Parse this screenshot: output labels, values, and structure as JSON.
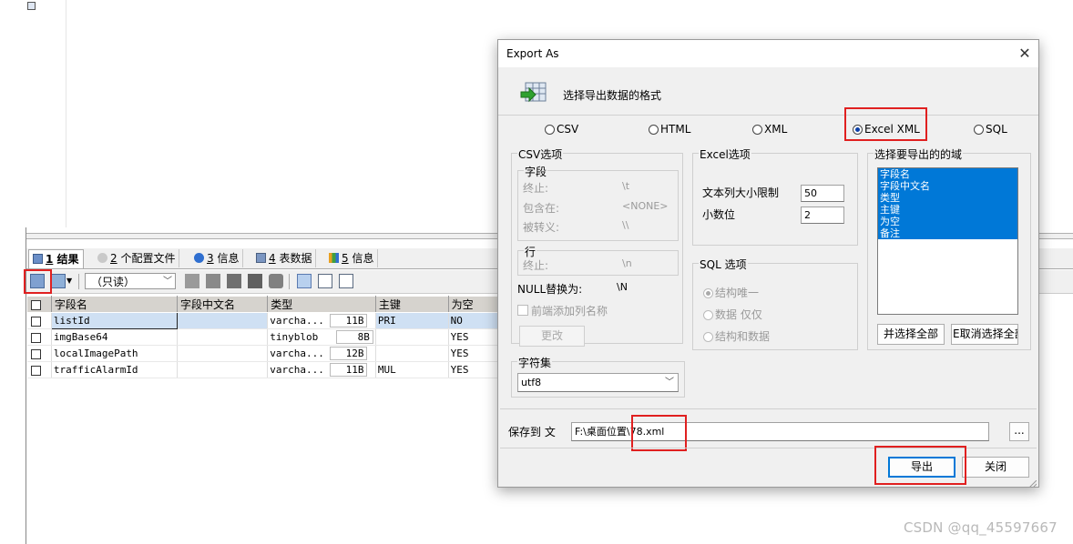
{
  "results_panel": {
    "tabs": [
      {
        "num": "1",
        "label": "结果"
      },
      {
        "num": "2",
        "label": "个配置文件"
      },
      {
        "num": "3",
        "label": "信息"
      },
      {
        "num": "4",
        "label": "表数据"
      },
      {
        "num": "5",
        "label": "信息"
      }
    ],
    "readonly_select": "（只读）",
    "columns": [
      "字段名",
      "字段中文名",
      "类型",
      "主键",
      "为空"
    ],
    "rows": [
      {
        "field": "listId",
        "cn_name": "",
        "type": "varcha...",
        "size": "11B",
        "key": "PRI",
        "nullable": "NO"
      },
      {
        "field": "imgBase64",
        "cn_name": "",
        "type": "tinyblob",
        "size": "8B",
        "key": "",
        "nullable": "YES"
      },
      {
        "field": "localImagePath",
        "cn_name": "",
        "type": "varcha...",
        "size": "12B",
        "key": "",
        "nullable": "YES"
      },
      {
        "field": "trafficAlarmId",
        "cn_name": "",
        "type": "varcha...",
        "size": "11B",
        "key": "MUL",
        "nullable": "YES"
      }
    ]
  },
  "export_dialog": {
    "title": "Export As",
    "close": "✕",
    "header_text": "选择导出数据的格式",
    "formats": [
      "CSV",
      "HTML",
      "XML",
      "Excel  XML",
      "SQL"
    ],
    "selected_format": "Excel  XML",
    "csv_options": {
      "title": "CSV选项",
      "field_group": "字段",
      "terminated_label": "终止:",
      "terminated_value": "\\t",
      "enclosed_label": "包含在:",
      "enclosed_value": "<NONE>",
      "escaped_label": "被转义:",
      "escaped_value": "\\\\",
      "line_group": "行",
      "line_terminated_label": "终止:",
      "line_terminated_value": "\\n",
      "null_label": "NULL替换为:",
      "null_value": "\\N",
      "add_header_label": "前端添加列名称",
      "change_button": "更改"
    },
    "excel_options": {
      "title": "Excel选项",
      "text_limit_label": "文本列大小限制",
      "text_limit_value": "50",
      "decimals_label": "小数位",
      "decimals_value": "2"
    },
    "sql_options": {
      "title": "SQL 选项",
      "opt1": "结构唯一",
      "opt2": "数据 仅仅",
      "opt3": "结构和数据"
    },
    "fields_section": {
      "title": "选择要导出的的域",
      "items": [
        "字段名",
        "字段中文名",
        "类型",
        "主键",
        "为空",
        "备注"
      ],
      "select_all": "并选择全部",
      "deselect_all": "E取消选择全部"
    },
    "charset": {
      "title": "字符集",
      "value": "utf8"
    },
    "save_to": {
      "label": "保存到 文",
      "value": "F:\\桌面位置\\78.xml",
      "browse": "..."
    },
    "export_button": "导出",
    "close_button": "关闭"
  },
  "watermark": "CSDN @qq_45597667",
  "colors": {
    "selection_blue": "#0078d7",
    "highlight_red": "#e02020",
    "row_select": "#cfe0f3"
  }
}
